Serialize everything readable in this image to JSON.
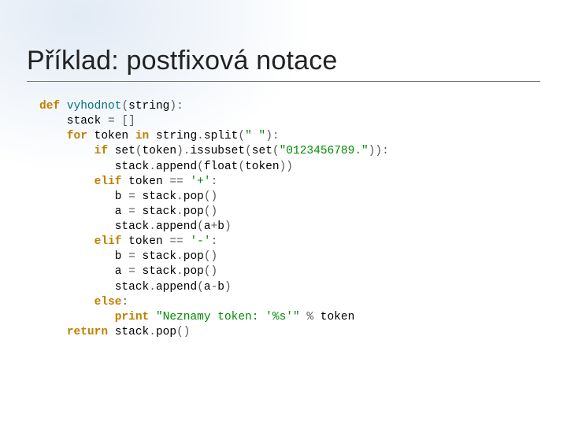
{
  "slide": {
    "title": "Příklad: postfixová notace"
  },
  "colors": {
    "keyword": "#c08000",
    "identifier": "#007080",
    "literal": "#008a00",
    "punct": "#5a5a5a"
  },
  "code": {
    "lines": [
      [
        [
          "kw",
          "def "
        ],
        [
          "name",
          "vyhodnot"
        ],
        [
          "op",
          "("
        ],
        [
          "call",
          "string"
        ],
        [
          "op",
          ")"
        ],
        [
          "op",
          ":"
        ]
      ],
      [
        [
          "call",
          "    stack "
        ],
        [
          "op",
          "="
        ],
        [
          "call",
          " "
        ],
        [
          "op",
          "[]"
        ]
      ],
      [
        [
          "call",
          "    "
        ],
        [
          "kw",
          "for "
        ],
        [
          "call",
          "token "
        ],
        [
          "kw",
          "in "
        ],
        [
          "call",
          "string"
        ],
        [
          "op",
          "."
        ],
        [
          "call",
          "split"
        ],
        [
          "op",
          "("
        ],
        [
          "lit",
          "\" \""
        ],
        [
          "op",
          ")"
        ],
        [
          "op",
          ":"
        ]
      ],
      [
        [
          "call",
          "        "
        ],
        [
          "kw",
          "if "
        ],
        [
          "call",
          "set"
        ],
        [
          "op",
          "("
        ],
        [
          "call",
          "token"
        ],
        [
          "op",
          ")"
        ],
        [
          "op",
          "."
        ],
        [
          "call",
          "issubset"
        ],
        [
          "op",
          "("
        ],
        [
          "call",
          "set"
        ],
        [
          "op",
          "("
        ],
        [
          "lit",
          "\"0123456789.\""
        ],
        [
          "op",
          "))"
        ],
        [
          "op",
          ":"
        ]
      ],
      [
        [
          "call",
          "           stack"
        ],
        [
          "op",
          "."
        ],
        [
          "call",
          "append"
        ],
        [
          "op",
          "("
        ],
        [
          "call",
          "float"
        ],
        [
          "op",
          "("
        ],
        [
          "call",
          "token"
        ],
        [
          "op",
          "))"
        ]
      ],
      [
        [
          "call",
          "        "
        ],
        [
          "kw",
          "elif "
        ],
        [
          "call",
          "token "
        ],
        [
          "op",
          "=="
        ],
        [
          "call",
          " "
        ],
        [
          "lit",
          "'+'"
        ],
        [
          "op",
          ":"
        ]
      ],
      [
        [
          "call",
          "           b "
        ],
        [
          "op",
          "="
        ],
        [
          "call",
          " stack"
        ],
        [
          "op",
          "."
        ],
        [
          "call",
          "pop"
        ],
        [
          "op",
          "()"
        ]
      ],
      [
        [
          "call",
          "           a "
        ],
        [
          "op",
          "="
        ],
        [
          "call",
          " stack"
        ],
        [
          "op",
          "."
        ],
        [
          "call",
          "pop"
        ],
        [
          "op",
          "()"
        ]
      ],
      [
        [
          "call",
          "           stack"
        ],
        [
          "op",
          "."
        ],
        [
          "call",
          "append"
        ],
        [
          "op",
          "("
        ],
        [
          "call",
          "a"
        ],
        [
          "op",
          "+"
        ],
        [
          "call",
          "b"
        ],
        [
          "op",
          ")"
        ]
      ],
      [
        [
          "call",
          "        "
        ],
        [
          "kw",
          "elif "
        ],
        [
          "call",
          "token "
        ],
        [
          "op",
          "=="
        ],
        [
          "call",
          " "
        ],
        [
          "lit",
          "'-'"
        ],
        [
          "op",
          ":"
        ]
      ],
      [
        [
          "call",
          "           b "
        ],
        [
          "op",
          "="
        ],
        [
          "call",
          " stack"
        ],
        [
          "op",
          "."
        ],
        [
          "call",
          "pop"
        ],
        [
          "op",
          "()"
        ]
      ],
      [
        [
          "call",
          "           a "
        ],
        [
          "op",
          "="
        ],
        [
          "call",
          " stack"
        ],
        [
          "op",
          "."
        ],
        [
          "call",
          "pop"
        ],
        [
          "op",
          "()"
        ]
      ],
      [
        [
          "call",
          "           stack"
        ],
        [
          "op",
          "."
        ],
        [
          "call",
          "append"
        ],
        [
          "op",
          "("
        ],
        [
          "call",
          "a"
        ],
        [
          "op",
          "-"
        ],
        [
          "call",
          "b"
        ],
        [
          "op",
          ")"
        ]
      ],
      [
        [
          "call",
          "        "
        ],
        [
          "kw",
          "else"
        ],
        [
          "op",
          ":"
        ]
      ],
      [
        [
          "call",
          "           "
        ],
        [
          "pr",
          "print "
        ],
        [
          "lit",
          "\"Neznamy token: '%s'\""
        ],
        [
          "call",
          " "
        ],
        [
          "op",
          "%"
        ],
        [
          "call",
          " token"
        ]
      ],
      [
        [
          "call",
          "    "
        ],
        [
          "kw",
          "return "
        ],
        [
          "call",
          "stack"
        ],
        [
          "op",
          "."
        ],
        [
          "call",
          "pop"
        ],
        [
          "op",
          "()"
        ]
      ]
    ]
  }
}
